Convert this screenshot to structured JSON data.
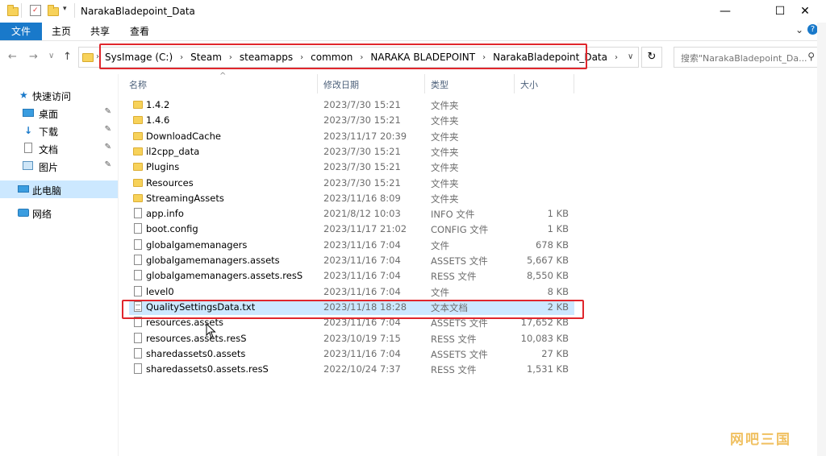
{
  "window": {
    "title": "NarakaBladepoint_Data",
    "minimize_glyph": "—",
    "maximize_glyph": "☐",
    "close_glyph": "✕"
  },
  "ribbon": {
    "file": "文件",
    "tabs": [
      "主页",
      "共享",
      "查看"
    ],
    "expand_glyph": "⌄",
    "help_glyph": "?"
  },
  "nav": {
    "back_glyph": "←",
    "forward_glyph": "→",
    "recent_glyph": "∨",
    "up_glyph": "↑",
    "breadcrumb": [
      "SysImage (C:)",
      "Steam",
      "steamapps",
      "common",
      "NARAKA BLADEPOINT",
      "NarakaBladepoint_Data"
    ],
    "dropdown_glyph": "∨",
    "refresh_glyph": "↻",
    "search_placeholder": "搜索\"NarakaBladepoint_Da..."
  },
  "sidebar": {
    "quick_access": "快速访问",
    "items": [
      {
        "label": "桌面",
        "icon": "desktop-icon"
      },
      {
        "label": "下载",
        "icon": "download-icon"
      },
      {
        "label": "文档",
        "icon": "document-icon"
      },
      {
        "label": "图片",
        "icon": "picture-icon"
      }
    ],
    "this_pc": "此电脑",
    "network": "网络",
    "pin_glyph": "📌"
  },
  "columns": {
    "name": "名称",
    "date": "修改日期",
    "type": "类型",
    "size": "大小",
    "sort_glyph": "^"
  },
  "files": [
    {
      "name": "1.4.2",
      "date": "2023/7/30 15:21",
      "type": "文件夹",
      "size": "",
      "kind": "folder"
    },
    {
      "name": "1.4.6",
      "date": "2023/7/30 15:21",
      "type": "文件夹",
      "size": "",
      "kind": "folder"
    },
    {
      "name": "DownloadCache",
      "date": "2023/11/17 20:39",
      "type": "文件夹",
      "size": "",
      "kind": "folder"
    },
    {
      "name": "il2cpp_data",
      "date": "2023/7/30 15:21",
      "type": "文件夹",
      "size": "",
      "kind": "folder"
    },
    {
      "name": "Plugins",
      "date": "2023/7/30 15:21",
      "type": "文件夹",
      "size": "",
      "kind": "folder"
    },
    {
      "name": "Resources",
      "date": "2023/7/30 15:21",
      "type": "文件夹",
      "size": "",
      "kind": "folder"
    },
    {
      "name": "StreamingAssets",
      "date": "2023/11/16 8:09",
      "type": "文件夹",
      "size": "",
      "kind": "folder"
    },
    {
      "name": "app.info",
      "date": "2021/8/12 10:03",
      "type": "INFO 文件",
      "size": "1 KB",
      "kind": "file"
    },
    {
      "name": "boot.config",
      "date": "2023/11/17 21:02",
      "type": "CONFIG 文件",
      "size": "1 KB",
      "kind": "file"
    },
    {
      "name": "globalgamemanagers",
      "date": "2023/11/16 7:04",
      "type": "文件",
      "size": "678 KB",
      "kind": "file"
    },
    {
      "name": "globalgamemanagers.assets",
      "date": "2023/11/16 7:04",
      "type": "ASSETS 文件",
      "size": "5,667 KB",
      "kind": "file"
    },
    {
      "name": "globalgamemanagers.assets.resS",
      "date": "2023/11/16 7:04",
      "type": "RESS 文件",
      "size": "8,550 KB",
      "kind": "file"
    },
    {
      "name": "level0",
      "date": "2023/11/16 7:04",
      "type": "文件",
      "size": "8 KB",
      "kind": "file"
    },
    {
      "name": "QualitySettingsData.txt",
      "date": "2023/11/18 18:28",
      "type": "文本文档",
      "size": "2 KB",
      "kind": "txt",
      "selected": true
    },
    {
      "name": "resources.assets",
      "date": "2023/11/16 7:04",
      "type": "ASSETS 文件",
      "size": "17,652 KB",
      "kind": "file"
    },
    {
      "name": "resources.assets.resS",
      "date": "2023/10/19 7:15",
      "type": "RESS 文件",
      "size": "10,083 KB",
      "kind": "file"
    },
    {
      "name": "sharedassets0.assets",
      "date": "2023/11/16 7:04",
      "type": "ASSETS 文件",
      "size": "27 KB",
      "kind": "file"
    },
    {
      "name": "sharedassets0.assets.resS",
      "date": "2022/10/24 7:37",
      "type": "RESS 文件",
      "size": "1,531 KB",
      "kind": "file"
    }
  ],
  "watermark": "网吧三国",
  "colors": {
    "accent": "#1979ca",
    "highlight": "#e0262c",
    "selection": "#cce8ff"
  }
}
